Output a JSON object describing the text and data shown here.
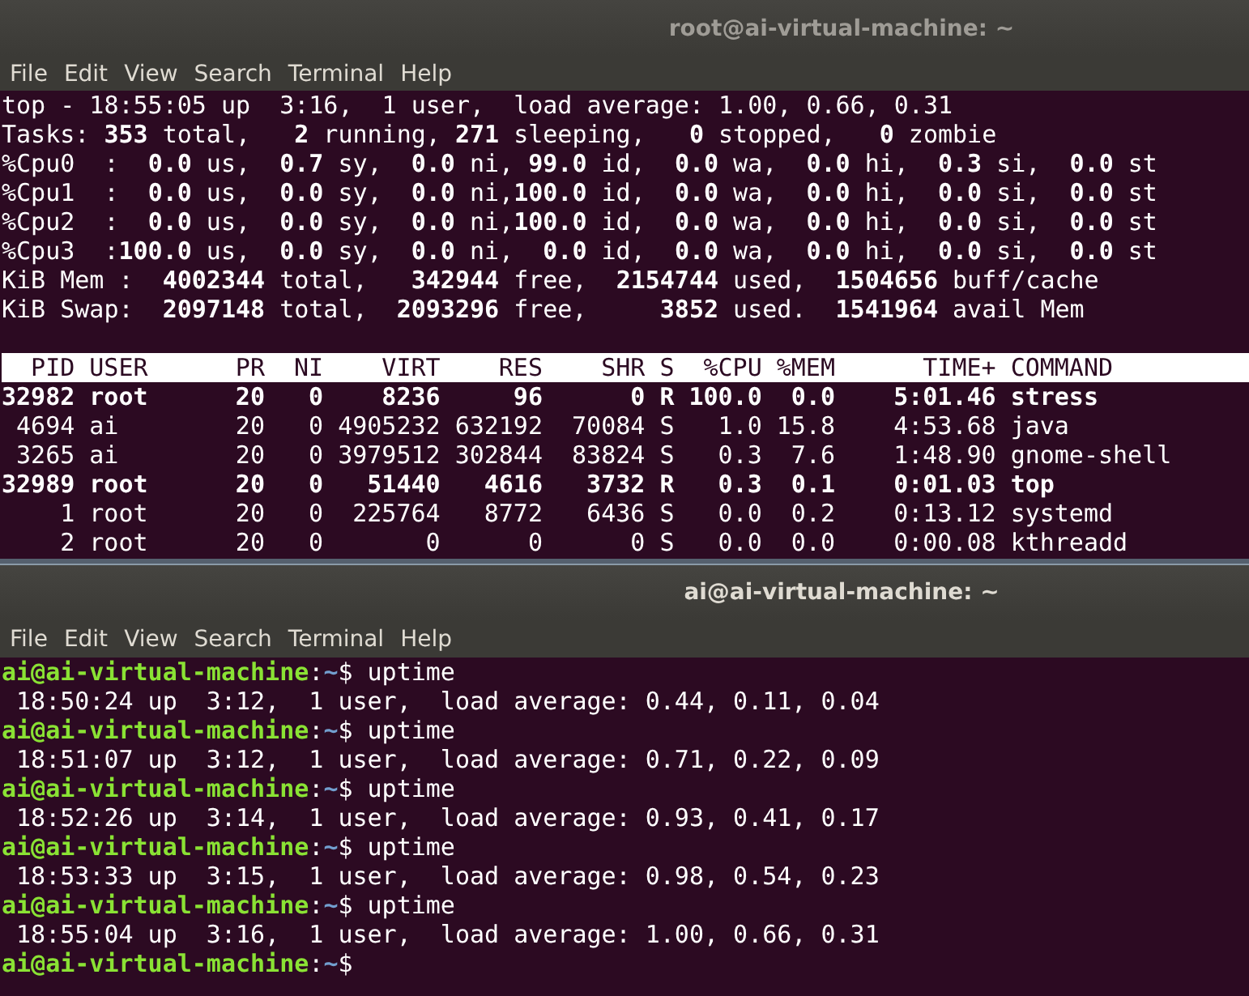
{
  "windows": [
    {
      "title": "root@ai-virtual-machine: ~",
      "active": false,
      "menu": [
        "File",
        "Edit",
        "View",
        "Search",
        "Terminal",
        "Help"
      ],
      "summary": [
        "top - 18:55:05 up  3:16,  1 user,  load average: 1.00, 0.66, 0.31",
        "Tasks: **353** total,   **2** running, **271** sleeping,   **0** stopped,   **0** zombie",
        "%Cpu0  :  **0.0** us,  **0.7** sy,  **0.0** ni, **99.0** id,  **0.0** wa,  **0.0** hi,  **0.3** si,  **0.0** st",
        "%Cpu1  :  **0.0** us,  **0.0** sy,  **0.0** ni,**100.0** id,  **0.0** wa,  **0.0** hi,  **0.0** si,  **0.0** st",
        "%Cpu2  :  **0.0** us,  **0.0** sy,  **0.0** ni,**100.0** id,  **0.0** wa,  **0.0** hi,  **0.0** si,  **0.0** st",
        "%Cpu3  :**100.0** us,  **0.0** sy,  **0.0** ni,  **0.0** id,  **0.0** wa,  **0.0** hi,  **0.0** si,  **0.0** st",
        "KiB Mem :  **4002344** total,   **342944** free,  **2154744** used,  **1504656** buff/cache",
        "KiB Swap:  **2097148** total,  **2093296** free,     **3852** used.  **1541964** avail Mem"
      ],
      "table": {
        "columns": [
          "PID",
          "USER",
          "PR",
          "NI",
          "VIRT",
          "RES",
          "SHR",
          "S",
          "%CPU",
          "%MEM",
          "TIME+",
          "COMMAND"
        ],
        "rows": [
          {
            "highlighted": true,
            "cells": [
              "32982",
              "root",
              "20",
              "0",
              "8236",
              "96",
              "0",
              "R",
              "100.0",
              "0.0",
              "5:01.46",
              "stress"
            ]
          },
          {
            "highlighted": false,
            "cells": [
              "4694",
              "ai",
              "20",
              "0",
              "4905232",
              "632192",
              "70084",
              "S",
              "1.0",
              "15.8",
              "4:53.68",
              "java"
            ]
          },
          {
            "highlighted": false,
            "cells": [
              "3265",
              "ai",
              "20",
              "0",
              "3979512",
              "302844",
              "83824",
              "S",
              "0.3",
              "7.6",
              "1:48.90",
              "gnome-shell"
            ]
          },
          {
            "highlighted": true,
            "cells": [
              "32989",
              "root",
              "20",
              "0",
              "51440",
              "4616",
              "3732",
              "R",
              "0.3",
              "0.1",
              "0:01.03",
              "top"
            ]
          },
          {
            "highlighted": false,
            "cells": [
              "1",
              "root",
              "20",
              "0",
              "225764",
              "8772",
              "6436",
              "S",
              "0.0",
              "0.2",
              "0:13.12",
              "systemd"
            ]
          },
          {
            "highlighted": false,
            "cells": [
              "2",
              "root",
              "20",
              "0",
              "0",
              "0",
              "0",
              "S",
              "0.0",
              "0.0",
              "0:00.08",
              "kthreadd"
            ]
          }
        ]
      }
    },
    {
      "title": "ai@ai-virtual-machine: ~",
      "active": true,
      "menu": [
        "File",
        "Edit",
        "View",
        "Search",
        "Terminal",
        "Help"
      ],
      "lines": [
        {
          "kind": "prompt",
          "user_host": "ai@ai-virtual-machine",
          "separator": ":",
          "path": "~",
          "symbol": "$",
          "command": "uptime"
        },
        {
          "kind": "output",
          "text": " 18:50:24 up  3:12,  1 user,  load average: 0.44, 0.11, 0.04"
        },
        {
          "kind": "prompt",
          "user_host": "ai@ai-virtual-machine",
          "separator": ":",
          "path": "~",
          "symbol": "$",
          "command": "uptime"
        },
        {
          "kind": "output",
          "text": " 18:51:07 up  3:12,  1 user,  load average: 0.71, 0.22, 0.09"
        },
        {
          "kind": "prompt",
          "user_host": "ai@ai-virtual-machine",
          "separator": ":",
          "path": "~",
          "symbol": "$",
          "command": "uptime"
        },
        {
          "kind": "output",
          "text": " 18:52:26 up  3:14,  1 user,  load average: 0.93, 0.41, 0.17"
        },
        {
          "kind": "prompt",
          "user_host": "ai@ai-virtual-machine",
          "separator": ":",
          "path": "~",
          "symbol": "$",
          "command": "uptime"
        },
        {
          "kind": "output",
          "text": " 18:53:33 up  3:15,  1 user,  load average: 0.98, 0.54, 0.23"
        },
        {
          "kind": "prompt",
          "user_host": "ai@ai-virtual-machine",
          "separator": ":",
          "path": "~",
          "symbol": "$",
          "command": "uptime"
        },
        {
          "kind": "output",
          "text": " 18:55:04 up  3:16,  1 user,  load average: 1.00, 0.66, 0.31"
        },
        {
          "kind": "prompt",
          "user_host": "ai@ai-virtual-machine",
          "separator": ":",
          "path": "~",
          "symbol": "$"
        }
      ]
    }
  ]
}
